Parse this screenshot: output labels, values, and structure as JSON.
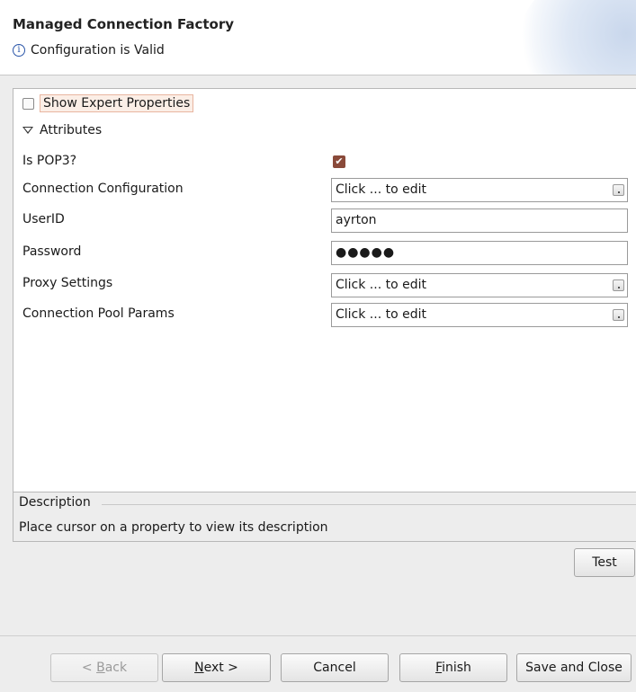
{
  "header": {
    "title": "Managed Connection Factory",
    "status": "Configuration is Valid",
    "status_icon": "info-icon"
  },
  "properties": {
    "show_expert_label": "Show Expert Properties",
    "show_expert_checked": false,
    "section_label": "Attributes",
    "rows": [
      {
        "label": "Is POP3?",
        "type": "checkbox",
        "checked": true
      },
      {
        "label": "Connection Configuration",
        "type": "edit",
        "value": "Click ... to edit"
      },
      {
        "label": "UserID",
        "type": "text",
        "value": "ayrton"
      },
      {
        "label": "Password",
        "type": "password",
        "value": "●●●●●"
      },
      {
        "label": "Proxy Settings",
        "type": "edit",
        "value": "Click ... to edit"
      },
      {
        "label": "Connection Pool Params",
        "type": "edit",
        "value": "Click ... to edit"
      }
    ]
  },
  "description": {
    "label": "Description",
    "text": "Place cursor on a property to view its description"
  },
  "buttons": {
    "test": "Test",
    "back_pre": "< ",
    "back_mn": "B",
    "back_post": "ack",
    "next_mn": "N",
    "next_post": "ext >",
    "cancel": "Cancel",
    "finish_mn": "F",
    "finish_post": "inish",
    "save_close": "Save and Close"
  },
  "colors": {
    "accent_check": "#8a4a3a",
    "highlight_bg": "#fbeee6"
  }
}
